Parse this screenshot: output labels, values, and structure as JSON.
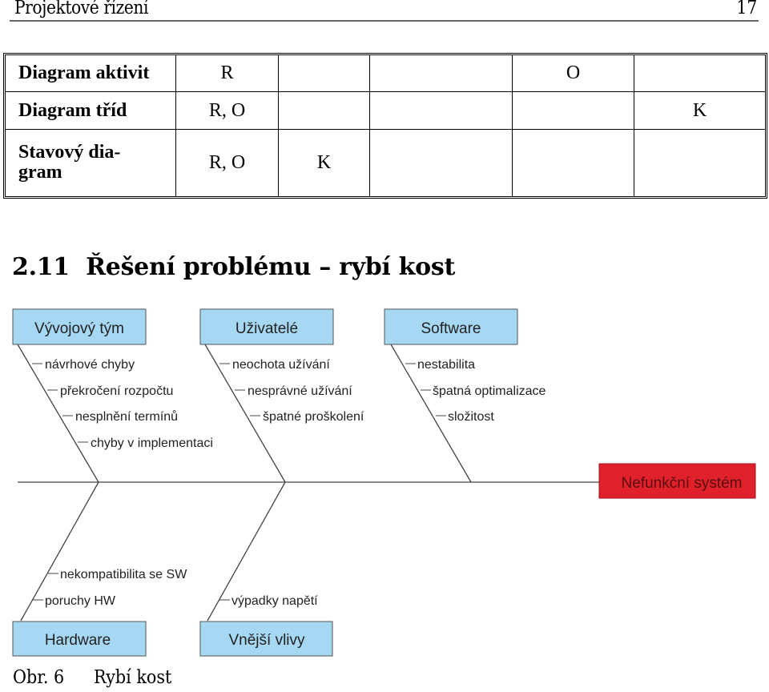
{
  "header": {
    "title": "Projektové řízení",
    "page_number": "17"
  },
  "table": {
    "rows": [
      {
        "label": "Diagram aktivit",
        "cells": [
          "R",
          "",
          "",
          "O",
          ""
        ]
      },
      {
        "label": "Diagram tříd",
        "cells": [
          "R, O",
          "",
          "",
          "",
          "K"
        ]
      },
      {
        "label": "Stavový dia-\ngram",
        "label_line1": "Stavový dia-",
        "label_line2": "gram",
        "cells": [
          "R, O",
          "K",
          "",
          "",
          ""
        ]
      }
    ]
  },
  "section": {
    "number": "2.11",
    "title": "Řešení problému – rybí kost"
  },
  "diagram": {
    "effect": "Nefunkční systém",
    "colors": {
      "category_fill": "#a6d8f4",
      "category_border": "#555555",
      "effect_fill": "#e0212b",
      "effect_text": "#5a0d10",
      "line": "#444444"
    },
    "categories_top": [
      {
        "name": "Vývojový tým",
        "causes": [
          "návrhové chyby",
          "překročení rozpočtu",
          "nesplnění termínů",
          "chyby v implementaci"
        ]
      },
      {
        "name": "Uživatelé",
        "causes": [
          "neochota užívání",
          "nesprávné užívání",
          "špatné proškolení"
        ]
      },
      {
        "name": "Software",
        "causes": [
          "nestabilita",
          "špatná optimalizace",
          "složitost"
        ]
      }
    ],
    "categories_bottom": [
      {
        "name": "Hardware",
        "causes": [
          "nekompatibilita se SW",
          "poruchy HW"
        ]
      },
      {
        "name": "Vnější vlivy",
        "causes": [
          "výpadky napětí"
        ]
      }
    ]
  },
  "caption": {
    "label": "Obr. 6",
    "text": "Rybí kost"
  }
}
